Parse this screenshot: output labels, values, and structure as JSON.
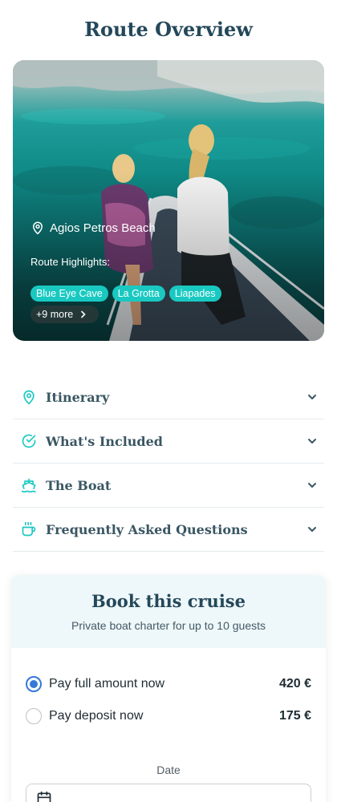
{
  "page": {
    "title": "Route Overview"
  },
  "hero": {
    "location": "Agios Petros Beach",
    "highlights_label": "Route Highlights:",
    "highlights": [
      "Blue Eye Cave",
      "La Grotta",
      "Liapades"
    ],
    "more_label": "+9 more",
    "icons": {
      "location": "map-pin-icon",
      "more": "chevron-right-icon"
    }
  },
  "accordion": {
    "items": [
      {
        "label": "Itinerary",
        "icon": "map-pin-icon"
      },
      {
        "label": "What's Included",
        "icon": "check-circle-icon"
      },
      {
        "label": "The Boat",
        "icon": "ship-icon"
      },
      {
        "label": "Frequently Asked Questions",
        "icon": "coffee-cup-icon"
      }
    ]
  },
  "booking": {
    "title": "Book this cruise",
    "subtitle": "Private boat charter for up to 10 guests",
    "options": [
      {
        "label": "Pay full amount now",
        "price": "420 €",
        "selected": true
      },
      {
        "label": "Pay deposit now",
        "price": "175 €",
        "selected": false
      }
    ],
    "date_label": "Date"
  },
  "colors": {
    "heading": "#24485a",
    "accent_teal": "#19c9c1",
    "radio_selected": "#3478d8",
    "booking_header_bg": "#eef7f9"
  }
}
